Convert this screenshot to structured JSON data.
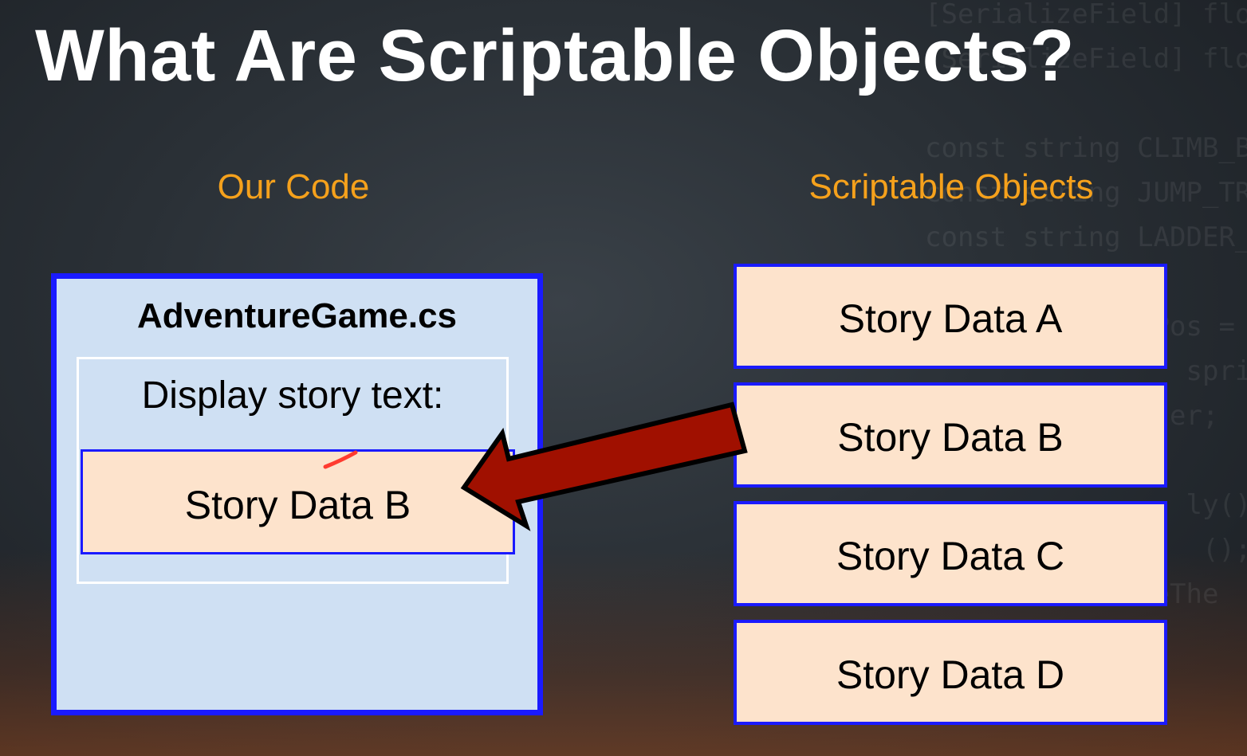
{
  "slide": {
    "title": "What Are Scriptable Objects?"
  },
  "columns": {
    "left_heading": "Our Code",
    "right_heading": "Scriptable Objects"
  },
  "code_box": {
    "title": "AdventureGame.cs",
    "display_label": "Display story text:",
    "slot_value": "Story Data B"
  },
  "scriptable_objects": [
    {
      "label": "Story Data A"
    },
    {
      "label": "Story Data B"
    },
    {
      "label": "Story Data C"
    },
    {
      "label": "Story Data D"
    }
  ],
  "colors": {
    "heading_accent": "#f5a11c",
    "box_border": "#1a1aff",
    "code_box_fill": "#cfe0f3",
    "data_fill": "#fde3cc",
    "arrow_fill": "#a01000"
  }
}
